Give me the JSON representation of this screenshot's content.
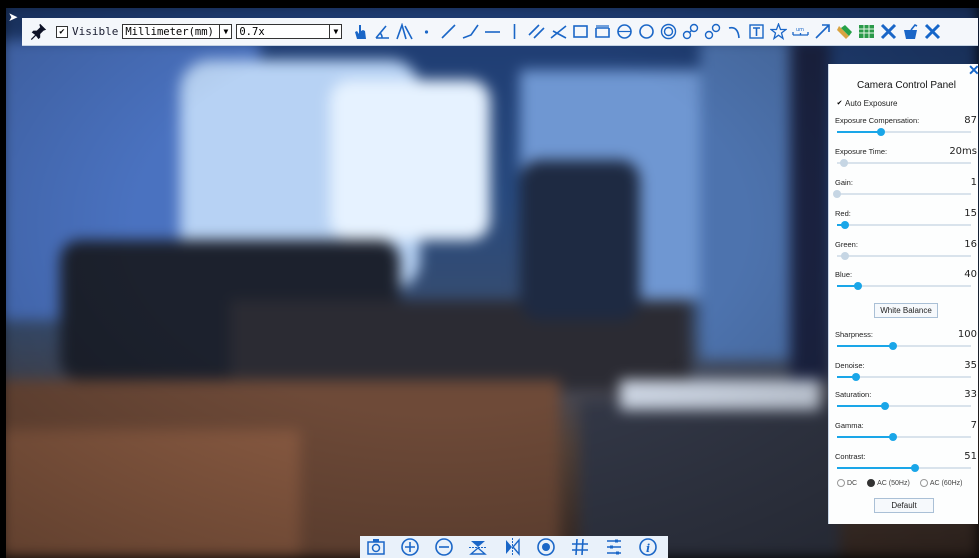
{
  "toolbar": {
    "visible_label": "Visible",
    "visible_checked": true,
    "unit_select": "Millimeter(mm)",
    "magnification_select": "0.7x",
    "tools": [
      "pointer-hand-icon",
      "angle-icon",
      "two-line-angle-icon",
      "point-icon",
      "line-icon",
      "polyline-icon",
      "horizontal-line-icon",
      "vertical-line-icon",
      "parallel-lines-icon",
      "cross-lines-icon",
      "rectangle-icon",
      "arc-rectangle-icon",
      "circle-icon",
      "three-point-circle-icon",
      "concentric-circle-icon",
      "link-icon",
      "unlink-icon",
      "arc-icon",
      "text-icon",
      "star-icon",
      "scale-bar-icon",
      "arrow-icon",
      "eraser-icon",
      "export-table-icon",
      "delete-all-icon",
      "clear-icon",
      "close-icon"
    ]
  },
  "camera_panel": {
    "title": "Camera Control Panel",
    "close": "✕",
    "auto_exposure_label": "Auto Exposure",
    "auto_exposure_checked": true,
    "exposure_compensation": {
      "label": "Exposure Compensation:",
      "value": "87",
      "level": 0.33
    },
    "exposure_time": {
      "label": "Exposure Time:",
      "value": "20ms",
      "level": 0.05
    },
    "gain": {
      "label": "Gain:",
      "value": "1",
      "level": 0.0
    },
    "red": {
      "label": "Red:",
      "value": "15",
      "level": 0.06
    },
    "green": {
      "label": "Green:",
      "value": "16",
      "level": 0.06
    },
    "blue": {
      "label": "Blue:",
      "value": "40",
      "level": 0.16
    },
    "white_balance_label": "White Balance",
    "sharpness": {
      "label": "Sharpness:",
      "value": "100",
      "level": 0.42
    },
    "denoise": {
      "label": "Denoise:",
      "value": "35",
      "level": 0.14
    },
    "saturation": {
      "label": "Saturation:",
      "value": "33",
      "level": 0.36
    },
    "gamma": {
      "label": "Gamma:",
      "value": "7",
      "level": 0.42
    },
    "contrast": {
      "label": "Contrast:",
      "value": "51",
      "level": 0.58
    },
    "freq_dc": "DC",
    "freq_ac50": "AC (50Hz)",
    "freq_ac60": "AC (60Hz)",
    "freq_selected": "AC (50Hz)",
    "default_label": "Default"
  },
  "bottom_toolbar": {
    "icons": [
      "camera-capture-icon",
      "zoom-in-icon",
      "zoom-out-icon",
      "flip-vertical-icon",
      "flip-horizontal-icon",
      "record-icon",
      "grid-icon",
      "settings-list-icon",
      "info-icon"
    ]
  }
}
